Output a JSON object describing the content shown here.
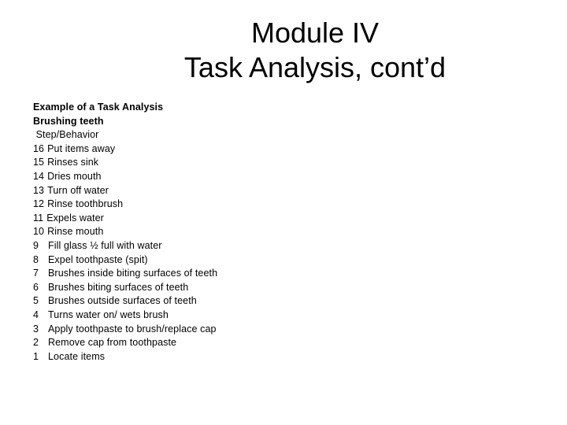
{
  "title": {
    "line1": "Module IV",
    "line2": "Task Analysis, cont’d"
  },
  "content": {
    "heading1": "Example of a Task Analysis",
    "heading2": "Brushing teeth",
    "column_label": " Step/Behavior",
    "steps": [
      {
        "num": "16",
        "text": "Put items away"
      },
      {
        "num": "15",
        "text": "Rinses sink"
      },
      {
        "num": "14",
        "text": "Dries mouth"
      },
      {
        "num": "13",
        "text": "Turn off water"
      },
      {
        "num": "12",
        "text": "Rinse toothbrush"
      },
      {
        "num": "11",
        "text": "Expels water"
      },
      {
        "num": "10",
        "text": "Rinse mouth"
      },
      {
        "num": "9",
        "text": "Fill glass ½ full with water"
      },
      {
        "num": "8",
        "text": "Expel toothpaste (spit)"
      },
      {
        "num": "7",
        "text": "Brushes inside biting surfaces of teeth"
      },
      {
        "num": "6",
        "text": "Brushes biting surfaces of teeth"
      },
      {
        "num": "5",
        "text": "Brushes outside surfaces of teeth"
      },
      {
        "num": "4",
        "text": "Turns water on/ wets brush"
      },
      {
        "num": "3",
        "text": "Apply toothpaste to brush/replace cap"
      },
      {
        "num": "2",
        "text": "Remove cap from toothpaste"
      },
      {
        "num": "1",
        "text": "Locate items"
      }
    ]
  }
}
